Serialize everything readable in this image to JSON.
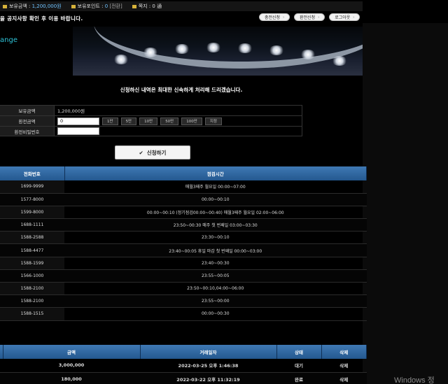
{
  "status": {
    "balance_label": "보유금액 :",
    "balance_value": "1,200,000원",
    "points_label": "보유포인트 :",
    "points_value": "0",
    "points_action": "[전환]",
    "message_label": "쪽지 : 0 通"
  },
  "notice": "을 공지사항 확인 후 이용 바랍니다.",
  "top_buttons": [
    "충전신청",
    "환전신청",
    "로그아웃"
  ],
  "banner_label": "ange",
  "tagline": "신청하신 내역은 최대한 신속하게 처리해 드리겠습니다.",
  "form": {
    "balance_label": "보유금액",
    "balance_value": "1,200,000원",
    "amount_label": "환전금액",
    "amount_value": "0",
    "amount_buttons": [
      "1만",
      "5만",
      "10만",
      "50만",
      "100만",
      "지정"
    ],
    "password_label": "환전비밀번호",
    "password_value": ""
  },
  "apply_button": "신청하기",
  "schedule": {
    "headers": [
      "전화번호",
      "점검시간"
    ],
    "rows": [
      [
        "1699-9999",
        "매월3째주 월요일 00:00~07:00"
      ],
      [
        "1577-8000",
        "00:00~00:10"
      ],
      [
        "1599-8000",
        "00:00~00:10 (정기점검00:00~00:40) 매월3째주 월요일 02:00~06:00"
      ],
      [
        "1688-1111",
        "23:50~00:30 매주 첫 번째일 03:00~03:30"
      ],
      [
        "1588-2588",
        "23:30~00:10"
      ],
      [
        "1588-4477",
        "23:40~00:05 휴일 마감 첫 번째일 00:00~03:00"
      ],
      [
        "1588-1599",
        "23:40~00:30"
      ],
      [
        "1566-1000",
        "23:55~00:05"
      ],
      [
        "1588-2100",
        "23:50~00:10,04:00~06:00"
      ],
      [
        "1588-2100",
        "23:55~00:00"
      ],
      [
        "1588-1515",
        "00:00~00:30"
      ]
    ]
  },
  "history": {
    "headers": [
      "",
      "금액",
      "거래일자",
      "상태",
      "삭제"
    ],
    "rows": [
      [
        "",
        "3,000,000",
        "2022-03-25 오후 1:46:38",
        "대기",
        "삭제"
      ],
      [
        "",
        "180,000",
        "2022-03-22 오후 11:32:19",
        "완료",
        "삭제"
      ]
    ]
  },
  "watermark": "Windows 정"
}
